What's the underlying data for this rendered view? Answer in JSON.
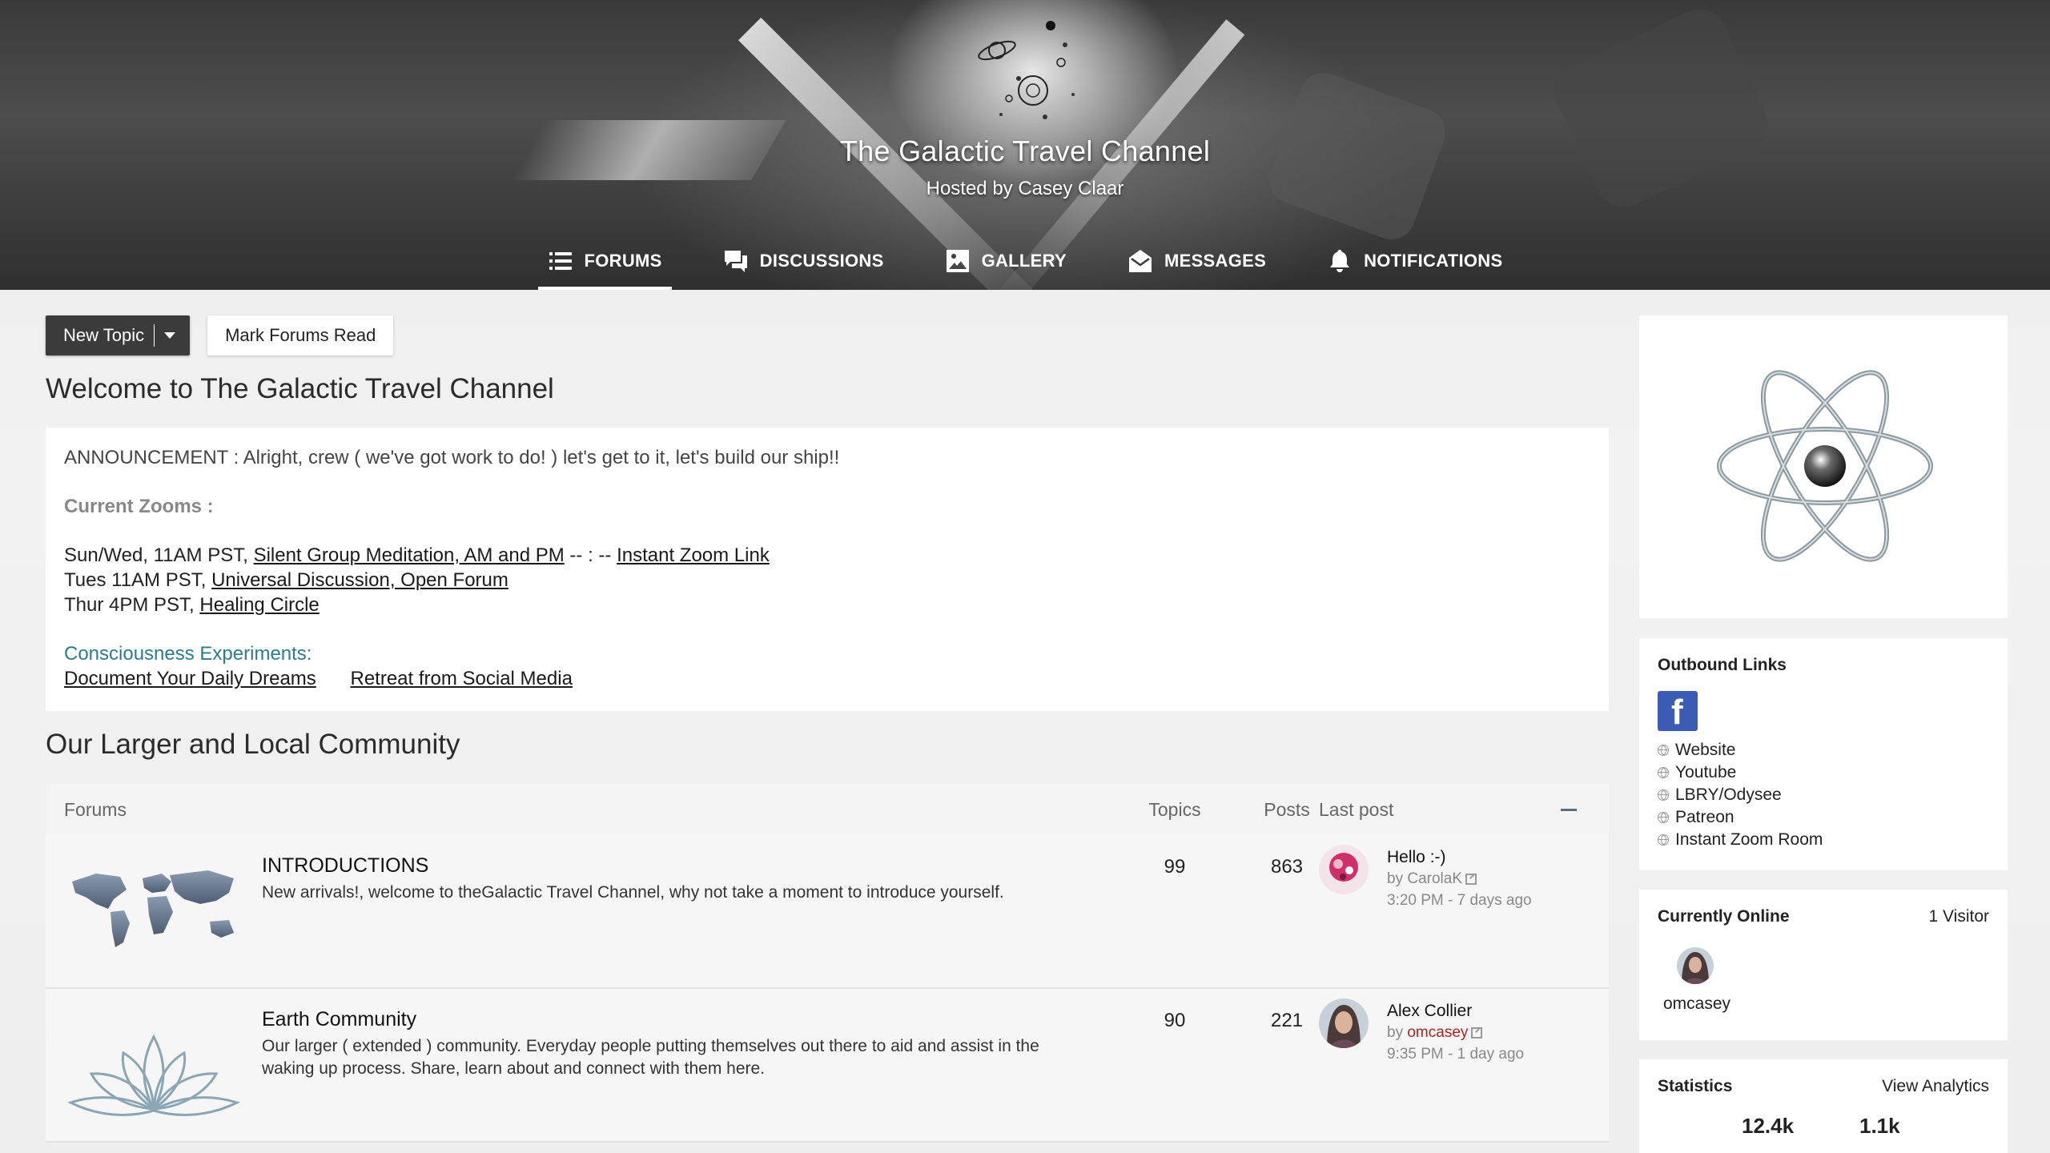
{
  "header": {
    "title": "The Galactic Travel Channel",
    "subtitle": "Hosted by Casey Claar",
    "nav": [
      {
        "label": "FORUMS",
        "icon": "list-icon",
        "active": true
      },
      {
        "label": "DISCUSSIONS",
        "icon": "chat-bubbles-icon",
        "active": false
      },
      {
        "label": "GALLERY",
        "icon": "image-icon",
        "active": false
      },
      {
        "label": "MESSAGES",
        "icon": "envelope-icon",
        "active": false
      },
      {
        "label": "NOTIFICATIONS",
        "icon": "bell-icon",
        "active": false
      }
    ]
  },
  "toolbar": {
    "new_topic_label": "New Topic",
    "mark_read_label": "Mark Forums Read"
  },
  "welcome_title": "Welcome to The Galactic Travel Channel",
  "announcement": {
    "line": "ANNOUNCEMENT : Alright, crew  ( we've got work to do! )  let's get to it, let's build our ship!!",
    "zooms_title": "Current Zooms :",
    "zoom1_prefix": "Sun/Wed, 11AM PST, ",
    "zoom1_link": "Silent Group Meditation, AM and PM",
    "zoom1_mid": " -- : -- ",
    "zoom1_link2": "Instant Zoom Link",
    "zoom2_prefix": "Tues 11AM PST, ",
    "zoom2_link": "Universal Discussion, Open Forum",
    "zoom3_prefix": "Thur 4PM PST, ",
    "zoom3_link": "Healing Circle",
    "experiments_title": "Consciousness Experiments:",
    "experiment1": "Document Your Daily Dreams",
    "experiment2": "Retreat from Social Media"
  },
  "community_title": "Our Larger and Local Community",
  "forum_table": {
    "headers": {
      "forums": "Forums",
      "topics": "Topics",
      "posts": "Posts",
      "last_post": "Last post"
    },
    "rows": [
      {
        "title": "INTRODUCTIONS",
        "description": "New arrivals!, welcome to theGalactic Travel Channel, why not take a moment to introduce yourself.",
        "topics": "99",
        "posts": "863",
        "last_post_title": "Hello :-)",
        "last_post_by_prefix": "by ",
        "last_post_user": "CarolaK",
        "last_post_time": "3:20 PM - 7 days ago"
      },
      {
        "title": "Earth Community",
        "description": "Our larger ( extended ) community. Everyday people putting themselves out there to aid and assist in the waking up process. Share, learn about and connect with them here.",
        "topics": "90",
        "posts": "221",
        "last_post_title": "Alex Collier",
        "last_post_by_prefix": "by ",
        "last_post_user": "omcasey",
        "last_post_time": "9:35 PM - 1 day ago"
      }
    ]
  },
  "sidebar": {
    "outbound_title": "Outbound Links",
    "facebook_icon_letter": "f",
    "links": [
      "Website",
      "Youtube",
      "LBRY/Odysee",
      "Patreon",
      "Instant Zoom Room"
    ],
    "online_title": "Currently Online",
    "online_count": "1  Visitor",
    "online_user": "omcasey",
    "stats_title": "Statistics",
    "stats_link": "View Analytics",
    "stat1": "12.4k",
    "stat2": "1.1k"
  },
  "colors": {
    "accent_link_teal": "#2e7a8f",
    "user_red": "#b22222",
    "facebook_blue": "#3b5bb5",
    "button_dark": "#3b3b3b"
  }
}
